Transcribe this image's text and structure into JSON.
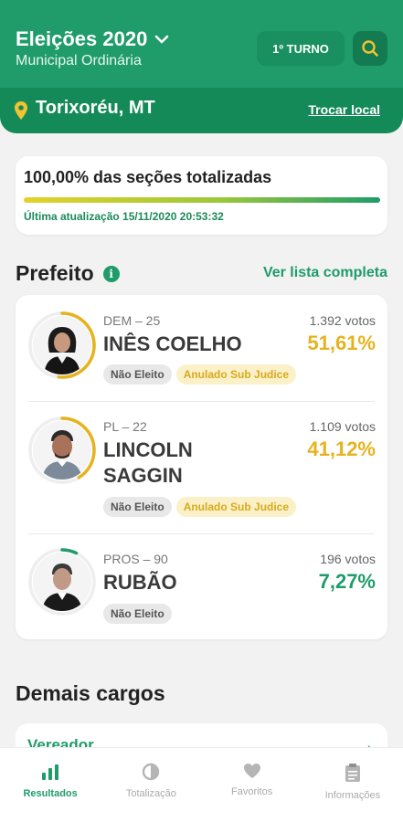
{
  "header": {
    "title": "Eleições 2020",
    "subtitle": "Municipal Ordinária",
    "turno_label": "1º TURNO",
    "location": "Torixoréu, MT",
    "change_location": "Trocar local"
  },
  "totalization": {
    "text": "100,00% das seções totalizadas",
    "progress": 1.0,
    "last_update": "Última atualização 15/11/2020 20:53:32"
  },
  "mayor_section": {
    "title": "Prefeito",
    "see_all": "Ver lista completa"
  },
  "candidates": [
    {
      "party": "DEM – 25",
      "name": "INÊS COELHO",
      "votes": "1.392 votos",
      "percent": "51,61%",
      "percent_value": 51.61,
      "percent_color": "#e6b31e",
      "badges": [
        "Não Eleito",
        "Anulado Sub Judice"
      ]
    },
    {
      "party": "PL – 22",
      "name": "LINCOLN SAGGIN",
      "votes": "1.109 votos",
      "percent": "41,12%",
      "percent_value": 41.12,
      "percent_color": "#e6b31e",
      "badges": [
        "Não Eleito",
        "Anulado Sub Judice"
      ]
    },
    {
      "party": "PROS – 90",
      "name": "RUBÃO",
      "votes": "196 votos",
      "percent": "7,27%",
      "percent_value": 7.27,
      "percent_color": "#1f9c6a",
      "badges": [
        "Não Eleito"
      ]
    }
  ],
  "other_offices": {
    "title": "Demais cargos",
    "first_item": "Vereador"
  },
  "tabbar": [
    {
      "label": "Resultados",
      "icon": "bar-chart-icon",
      "active": true
    },
    {
      "label": "Totalização",
      "icon": "pie-chart-icon",
      "active": false
    },
    {
      "label": "Favoritos",
      "icon": "heart-icon",
      "active": false
    },
    {
      "label": "Informações",
      "icon": "clipboard-icon",
      "active": false
    }
  ],
  "colors": {
    "brand_green": "#1f9c6a",
    "dark_green": "#158a59",
    "yellow": "#e6b31e"
  }
}
